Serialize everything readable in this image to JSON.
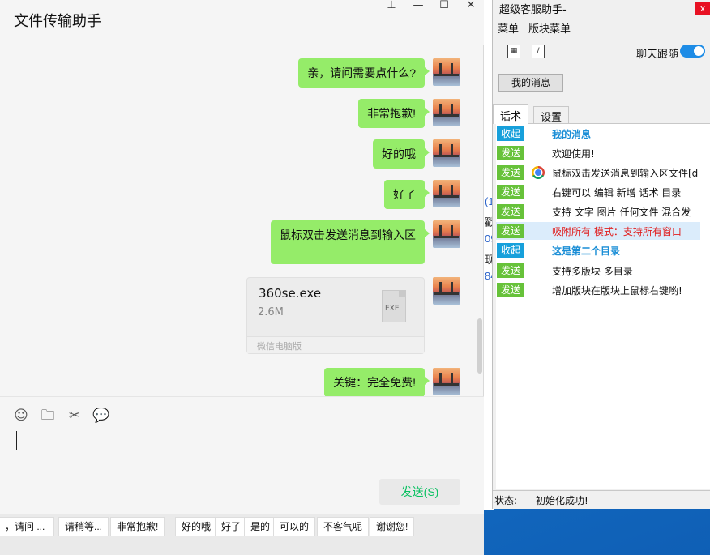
{
  "chat": {
    "title": "文件传输助手",
    "window_buttons": {
      "pin": "⊥",
      "minimize": "—",
      "maximize": "☐",
      "close": "✕"
    },
    "messages": [
      {
        "text": "亲，请问需要点什么?"
      },
      {
        "text": "非常抱歉!"
      },
      {
        "text": "好的哦"
      },
      {
        "text": "好了"
      },
      {
        "text": "鼠标双击发送消息到输入区"
      },
      {
        "text": "关键：完全免费!"
      }
    ],
    "file": {
      "name": "360se.exe",
      "size": "2.6M",
      "type": "EXE",
      "source": "微信电脑版"
    },
    "toolbar_icons": [
      "emoji-icon",
      "folder-icon",
      "scissors-icon",
      "chat-bubble-icon"
    ],
    "send_label": "发送(S)"
  },
  "quick_phrases": [
    "，请问 ...",
    "请稍等...",
    "非常抱歉!",
    "好的哦",
    "好了",
    "是的",
    "可以的",
    "不客气呢",
    "谢谢您!"
  ],
  "desktop_fragments": [
    "(1",
    "戳",
    "09",
    "现",
    "84"
  ],
  "helper": {
    "title": "超级客服助手-",
    "close": "x",
    "menu": [
      "菜单",
      "版块菜单"
    ],
    "follow_label": "聊天跟随",
    "follow_on": true,
    "my_messages_button": "我的消息",
    "tabs": [
      "话术",
      "设置"
    ],
    "rows": [
      {
        "badge": "收起",
        "kind": "collapse",
        "text": "我的消息",
        "style": "header"
      },
      {
        "badge": "发送",
        "kind": "send",
        "text": "欢迎使用!",
        "style": "normal"
      },
      {
        "badge": "发送",
        "kind": "send",
        "text": "鼠标双击发送消息到输入区文件[d",
        "style": "normal",
        "icon": "chrome-icon"
      },
      {
        "badge": "发送",
        "kind": "send",
        "text": "右键可以 编辑 新增 话术 目录",
        "style": "normal"
      },
      {
        "badge": "发送",
        "kind": "send",
        "text": "支持 文字 图片 任何文件 混合发",
        "style": "normal"
      },
      {
        "badge": "发送",
        "kind": "send",
        "text": "吸附所有 模式：支持所有窗口",
        "style": "red"
      },
      {
        "badge": "收起",
        "kind": "collapse",
        "text": "这是第二个目录",
        "style": "header"
      },
      {
        "badge": "发送",
        "kind": "send",
        "text": "支持多版块 多目录",
        "style": "normal"
      },
      {
        "badge": "发送",
        "kind": "send",
        "text": "增加版块在版块上鼠标右键哟!",
        "style": "normal"
      }
    ],
    "status_label": "状态:",
    "status_value": "初始化成功!"
  },
  "colors": {
    "bubble": "#95ec69",
    "send_text": "#07c160",
    "badge_collapse": "#17a0db",
    "badge_send": "#67c23a",
    "toggle": "#1e8ce6"
  }
}
